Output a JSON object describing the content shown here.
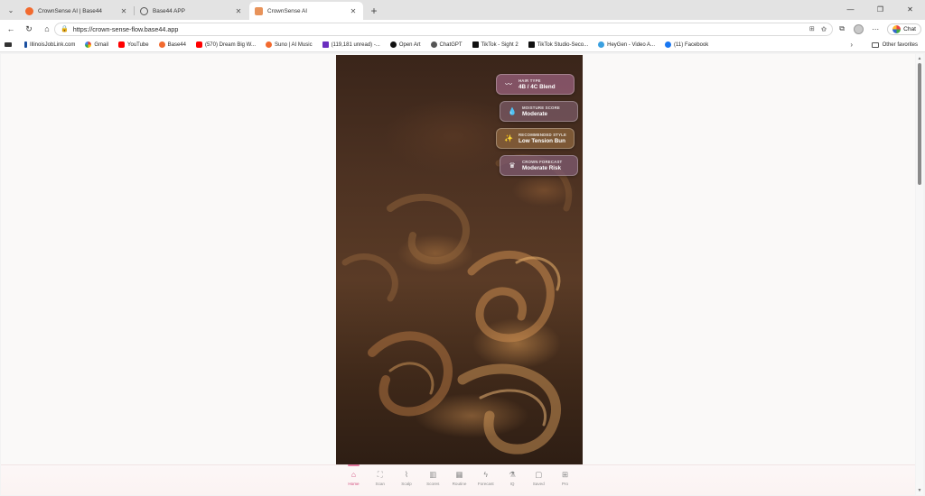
{
  "browser": {
    "tabs": [
      {
        "title": "CrownSense AI | Base44",
        "icon": "orange-dot-icon",
        "active": false
      },
      {
        "title": "Base44 APP",
        "icon": "globe-icon",
        "active": false
      },
      {
        "title": "CrownSense AI",
        "icon": "app-icon",
        "active": true
      }
    ],
    "url": "https://crown-sense-flow.base44.app",
    "copilot_label": "Chat",
    "bookmarks": [
      {
        "label": "",
        "icon": "tv-icon",
        "color": "#333333"
      },
      {
        "label": "IllinoisJobLink.com",
        "icon": "illinois-icon",
        "color": "#1a4fa0"
      },
      {
        "label": "Gmail",
        "icon": "google-icon",
        "color": "#ea4335"
      },
      {
        "label": "YouTube",
        "icon": "youtube-icon",
        "color": "#ff0000"
      },
      {
        "label": "Base44",
        "icon": "base44-icon",
        "color": "#f26a2e"
      },
      {
        "label": "(570) Dream Big W...",
        "icon": "youtube-icon",
        "color": "#ff0000"
      },
      {
        "label": "Suno | AI Music",
        "icon": "suno-icon",
        "color": "#f26a2e"
      },
      {
        "label": "(119,181 unread) -...",
        "icon": "mail-icon",
        "color": "#6b2fbf"
      },
      {
        "label": "Open Art",
        "icon": "openart-icon",
        "color": "#111111"
      },
      {
        "label": "ChatGPT",
        "icon": "chatgpt-icon",
        "color": "#555555"
      },
      {
        "label": "TikTok - Sight 2",
        "icon": "tiktok-icon",
        "color": "#111111"
      },
      {
        "label": "TikTok Studio-Seco...",
        "icon": "tiktok-icon",
        "color": "#111111"
      },
      {
        "label": "HeyGen - Video A...",
        "icon": "heygen-icon",
        "color": "#3aa0e0"
      },
      {
        "label": "(11) Facebook",
        "icon": "facebook-icon",
        "color": "#1877f2"
      }
    ],
    "other_favorites": "Other favorites"
  },
  "app": {
    "badges": [
      {
        "label": "HAIR TYPE",
        "value": "4B / 4C Blend",
        "icon": "curl-icon"
      },
      {
        "label": "MOISTURE SCORE",
        "value": "Moderate",
        "icon": "droplet-icon"
      },
      {
        "label": "RECOMMENDED STYLE",
        "value": "Low Tension Bun",
        "icon": "sparkle-icon"
      },
      {
        "label": "CROWN FORECAST",
        "value": "Moderate Risk",
        "icon": "crown-icon"
      }
    ],
    "nav": [
      {
        "label": "Home",
        "icon": "home-icon",
        "active": true
      },
      {
        "label": "Scan",
        "icon": "scan-icon",
        "active": false
      },
      {
        "label": "Scalp",
        "icon": "activity-icon",
        "active": false
      },
      {
        "label": "Scores",
        "icon": "bar-chart-icon",
        "active": false
      },
      {
        "label": "Routine",
        "icon": "calendar-icon",
        "active": false
      },
      {
        "label": "Forecast",
        "icon": "zap-icon",
        "active": false
      },
      {
        "label": "IQ",
        "icon": "flask-icon",
        "active": false
      },
      {
        "label": "Saved",
        "icon": "bookmark-icon",
        "active": false
      },
      {
        "label": "Pro",
        "icon": "grid-icon",
        "active": false
      }
    ]
  }
}
